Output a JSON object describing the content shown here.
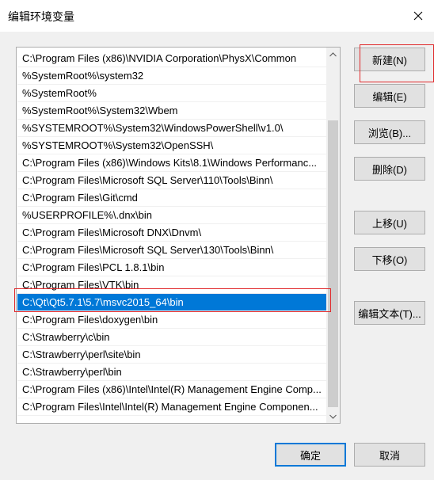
{
  "window": {
    "title": "编辑环境变量"
  },
  "icons": {
    "close": "close-icon",
    "scroll_up": "chevron-up-icon",
    "scroll_down": "chevron-down-icon"
  },
  "path_list": {
    "items": [
      "C:\\Program Files (x86)\\NVIDIA Corporation\\PhysX\\Common",
      "%SystemRoot%\\system32",
      "%SystemRoot%",
      "%SystemRoot%\\System32\\Wbem",
      "%SYSTEMROOT%\\System32\\WindowsPowerShell\\v1.0\\",
      "%SYSTEMROOT%\\System32\\OpenSSH\\",
      "C:\\Program Files (x86)\\Windows Kits\\8.1\\Windows Performanc...",
      "C:\\Program Files\\Microsoft SQL Server\\110\\Tools\\Binn\\",
      "C:\\Program Files\\Git\\cmd",
      "%USERPROFILE%\\.dnx\\bin",
      "C:\\Program Files\\Microsoft DNX\\Dnvm\\",
      "C:\\Program Files\\Microsoft SQL Server\\130\\Tools\\Binn\\",
      "C:\\Program Files\\PCL 1.8.1\\bin",
      "C:\\Program Files\\VTK\\bin",
      "C:\\Qt\\Qt5.7.1\\5.7\\msvc2015_64\\bin",
      "C:\\Program Files\\doxygen\\bin",
      "C:\\Strawberry\\c\\bin",
      "C:\\Strawberry\\perl\\site\\bin",
      "C:\\Strawberry\\perl\\bin",
      "C:\\Program Files (x86)\\Intel\\Intel(R) Management Engine Comp...",
      "C:\\Program Files\\Intel\\Intel(R) Management Engine Componen..."
    ],
    "selected_index": 14
  },
  "buttons": {
    "new": "新建(N)",
    "edit": "编辑(E)",
    "browse": "浏览(B)...",
    "delete": "删除(D)",
    "move_up": "上移(U)",
    "move_down": "下移(O)",
    "edit_text": "编辑文本(T)...",
    "ok": "确定",
    "cancel": "取消"
  },
  "colors": {
    "selection": "#0078d7",
    "highlight_annotation": "#e0292b"
  }
}
